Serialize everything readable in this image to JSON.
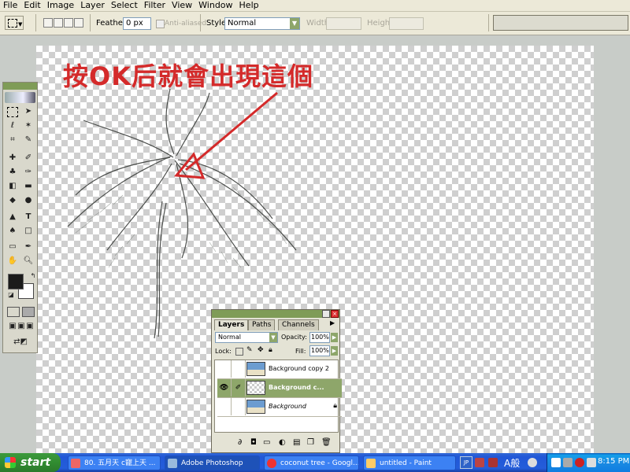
{
  "menu": [
    "File",
    "Edit",
    "Image",
    "Layer",
    "Select",
    "Filter",
    "View",
    "Window",
    "Help"
  ],
  "options_bar": {
    "feather_label": "Feather:",
    "feather_value": "0 px",
    "anti_aliased_label": "Anti-aliased",
    "style_label": "Style:",
    "style_value": "Normal",
    "width_label": "Width:",
    "height_label": "Height:"
  },
  "annotation": {
    "text": "按OK后就會出現這個",
    "color": "#d42a2a"
  },
  "layers_palette": {
    "tabs": [
      "Layers",
      "Paths",
      "Channels"
    ],
    "blend_mode": "Normal",
    "opacity_label": "Opacity:",
    "opacity_value": "100%",
    "lock_label": "Lock:",
    "fill_label": "Fill:",
    "fill_value": "100%",
    "layers": [
      {
        "name": "Background copy 2",
        "visible": false,
        "selected": false
      },
      {
        "name": "Background c...",
        "visible": true,
        "selected": true
      },
      {
        "name": "Background",
        "visible": false,
        "selected": false
      }
    ]
  },
  "taskbar": {
    "start_label": "start",
    "tasks": [
      {
        "label": "80. 五月天 c寵上天 ..."
      },
      {
        "label": "Adobe Photoshop"
      },
      {
        "label": "coconut tree - Googl..."
      },
      {
        "label": "untitled - Paint"
      }
    ],
    "lang": "JP",
    "ime_label": "A般",
    "clock": "8:15 PM"
  },
  "colors": {
    "title_green": "#7f9c57",
    "annotation_red": "#d42a2a",
    "taskbar_blue": "#245dda"
  }
}
